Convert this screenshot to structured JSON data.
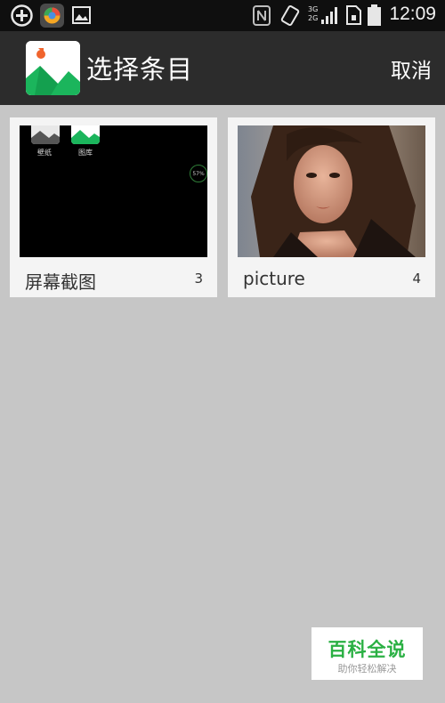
{
  "status_bar": {
    "time": "12:09",
    "network_3g": "3G",
    "network_2g": "2G",
    "icons": [
      "add-circle-icon",
      "app-store-icon",
      "image-icon",
      "nfc-icon",
      "rotation-icon",
      "signal-icon",
      "sim-icon",
      "battery-icon"
    ]
  },
  "header": {
    "title": "选择条目",
    "cancel_label": "取消",
    "app_icon": "gallery-icon"
  },
  "albums": [
    {
      "name": "屏幕截图",
      "count": "3",
      "thumb_labels": [
        "壁纸",
        "图库"
      ],
      "thumb_progress": "57%"
    },
    {
      "name": "picture",
      "count": "4"
    }
  ],
  "watermark": {
    "main": "百科全说",
    "sub": "助你轻松解决"
  },
  "colors": {
    "background": "#c6c6c6",
    "action_bar": "#2c2c2c",
    "status_bar": "#0f0f0f",
    "card": "#f4f4f4",
    "brand_green": "#2ab043"
  }
}
